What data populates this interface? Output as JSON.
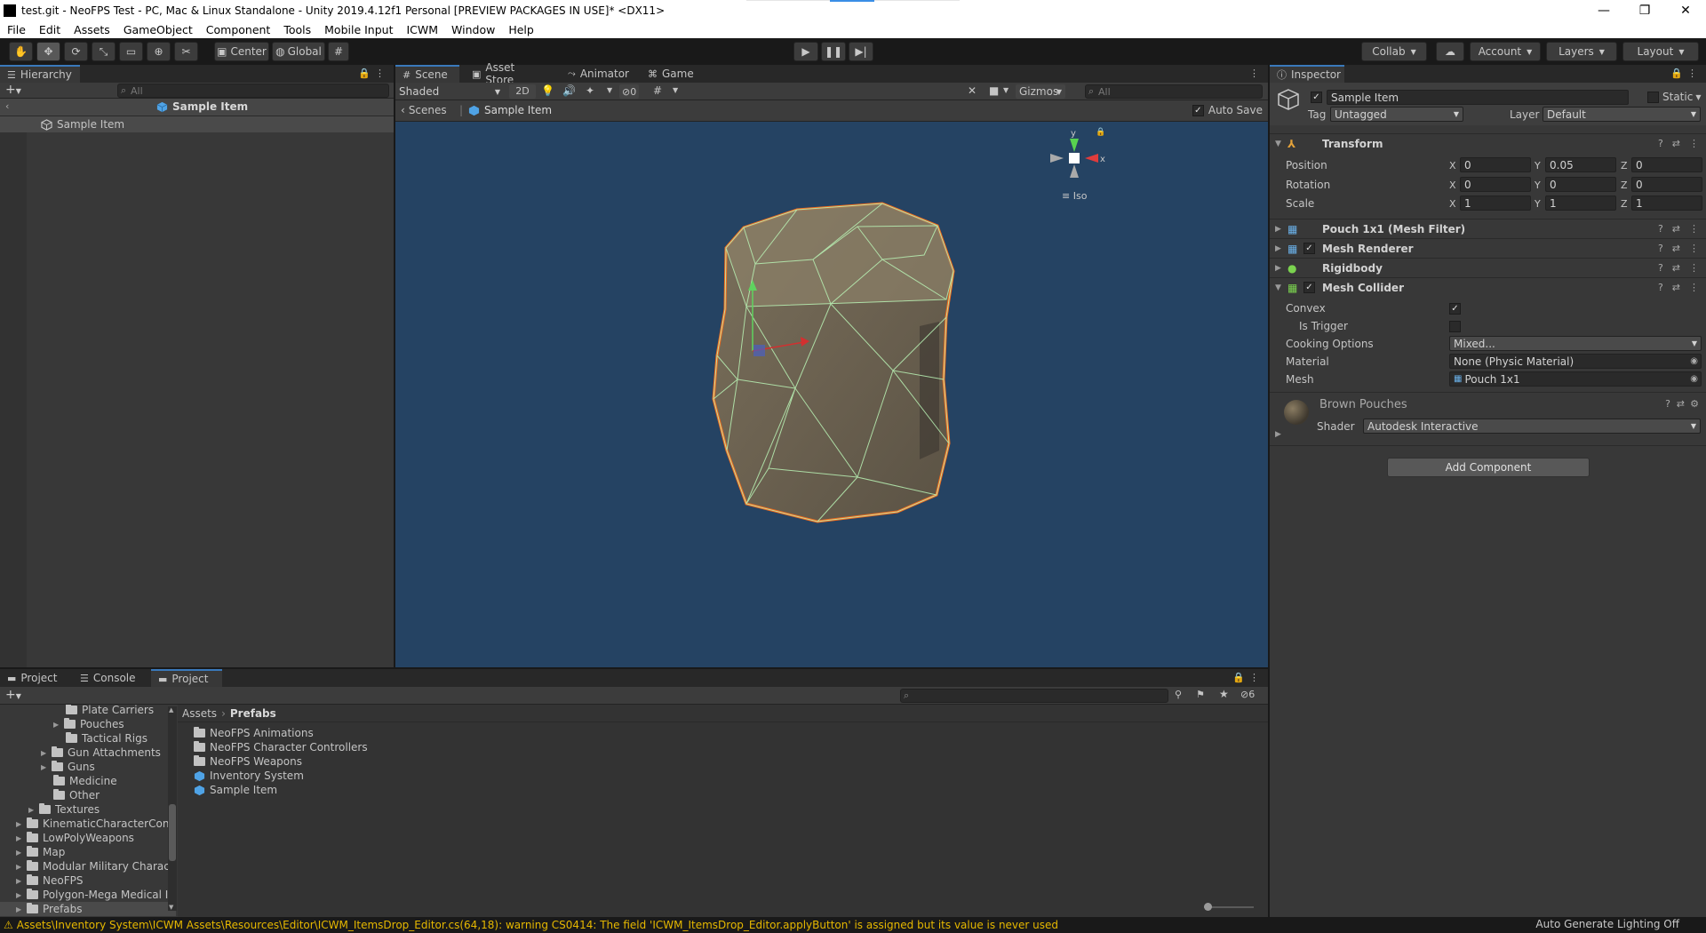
{
  "window": {
    "title": "test.git - NeoFPS Test - PC, Mac & Linux Standalone - Unity 2019.4.12f1 Personal [PREVIEW PACKAGES IN USE]* <DX11>",
    "minimize": "—",
    "maximize": "❐",
    "close": "✕"
  },
  "menu": [
    "File",
    "Edit",
    "Assets",
    "GameObject",
    "Component",
    "Tools",
    "Mobile Input",
    "ICWM",
    "Window",
    "Help"
  ],
  "toolbar": {
    "center_label": "Center",
    "global_label": "Global",
    "collab_label": "Collab",
    "account_label": "Account",
    "layers_label": "Layers",
    "layout_label": "Layout"
  },
  "hierarchy": {
    "tab_label": "Hierarchy",
    "search_placeholder": "All",
    "prefab_header": "Sample Item",
    "items": [
      "Sample Item"
    ]
  },
  "scene": {
    "tabs": [
      "Scene",
      "Asset Store",
      "Animator",
      "Game"
    ],
    "shading_mode": "Shaded",
    "btn_2d": "2D",
    "hidden_count": "0",
    "gizmos_label": "Gizmos",
    "search_placeholder": "All",
    "breadcrumb_root": "Scenes",
    "breadcrumb_item": "Sample Item",
    "auto_save_label": "Auto Save",
    "auto_save_checked": true,
    "projection_label": "Iso",
    "axis_y": "y",
    "axis_x": "x",
    "background_color": "#254363",
    "outline_color": "#f26b1d",
    "wire_color": "#b9f2b4"
  },
  "inspector": {
    "tab_label": "Inspector",
    "object_name": "Sample Item",
    "static_label": "Static",
    "tag_label": "Tag",
    "tag_value": "Untagged",
    "layer_label": "Layer",
    "layer_value": "Default",
    "transform": {
      "name": "Transform",
      "position_label": "Position",
      "rotation_label": "Rotation",
      "scale_label": "Scale",
      "position": {
        "x": "0",
        "y": "0.05",
        "z": "0"
      },
      "rotation": {
        "x": "0",
        "y": "0",
        "z": "0"
      },
      "scale": {
        "x": "1",
        "y": "1",
        "z": "1"
      }
    },
    "components": [
      "Pouch 1x1 (Mesh Filter)",
      "Mesh Renderer",
      "Rigidbody",
      "Mesh Collider"
    ],
    "mesh_collider": {
      "convex_label": "Convex",
      "convex_checked": true,
      "is_trigger_label": "Is Trigger",
      "is_trigger_checked": false,
      "cooking_label": "Cooking Options",
      "cooking_value": "Mixed...",
      "material_label": "Material",
      "material_value": "None (Physic Material)",
      "mesh_label": "Mesh",
      "mesh_value": "Pouch 1x1"
    },
    "material": {
      "name": "Brown Pouches",
      "shader_label": "Shader",
      "shader_value": "Autodesk Interactive"
    },
    "add_component_label": "Add Component"
  },
  "project": {
    "tabs": [
      "Project",
      "Console",
      "Project"
    ],
    "hidden_count": "6",
    "breadcrumb_root": "Assets",
    "breadcrumb_current": "Prefabs",
    "tree": [
      {
        "label": "Plate Carriers",
        "depth": 4,
        "expand": false
      },
      {
        "label": "Pouches",
        "depth": 3,
        "expand": true
      },
      {
        "label": "Tactical Rigs",
        "depth": 4,
        "expand": false
      },
      {
        "label": "Gun Attachments",
        "depth": 2,
        "expand": true
      },
      {
        "label": "Guns",
        "depth": 2,
        "expand": true
      },
      {
        "label": "Medicine",
        "depth": 3,
        "expand": false
      },
      {
        "label": "Other",
        "depth": 3,
        "expand": false
      },
      {
        "label": "Textures",
        "depth": 1,
        "expand": true
      },
      {
        "label": "KinematicCharacterCont",
        "depth": 0,
        "expand": true
      },
      {
        "label": "LowPolyWeapons",
        "depth": 0,
        "expand": true
      },
      {
        "label": "Map",
        "depth": 0,
        "expand": true
      },
      {
        "label": "Modular Military Charact",
        "depth": 0,
        "expand": true
      },
      {
        "label": "NeoFPS",
        "depth": 0,
        "expand": true
      },
      {
        "label": "Polygon-Mega Medical I",
        "depth": 0,
        "expand": true
      },
      {
        "label": "Prefabs",
        "depth": 0,
        "expand": true
      }
    ],
    "assets": [
      {
        "label": "NeoFPS Animations",
        "kind": "folder"
      },
      {
        "label": "NeoFPS Character Controllers",
        "kind": "folder"
      },
      {
        "label": "NeoFPS Weapons",
        "kind": "folder"
      },
      {
        "label": "Inventory System",
        "kind": "prefab"
      },
      {
        "label": "Sample Item",
        "kind": "prefab"
      }
    ]
  },
  "status": {
    "warning": "Assets\\Inventory System\\ICWM Assets\\Resources\\Editor\\ICWM_ItemsDrop_Editor.cs(64,18): warning CS0414: The field 'ICWM_ItemsDrop_Editor.applyButton' is assigned but its value is never used",
    "right_text": "Auto Generate Lighting Off"
  }
}
